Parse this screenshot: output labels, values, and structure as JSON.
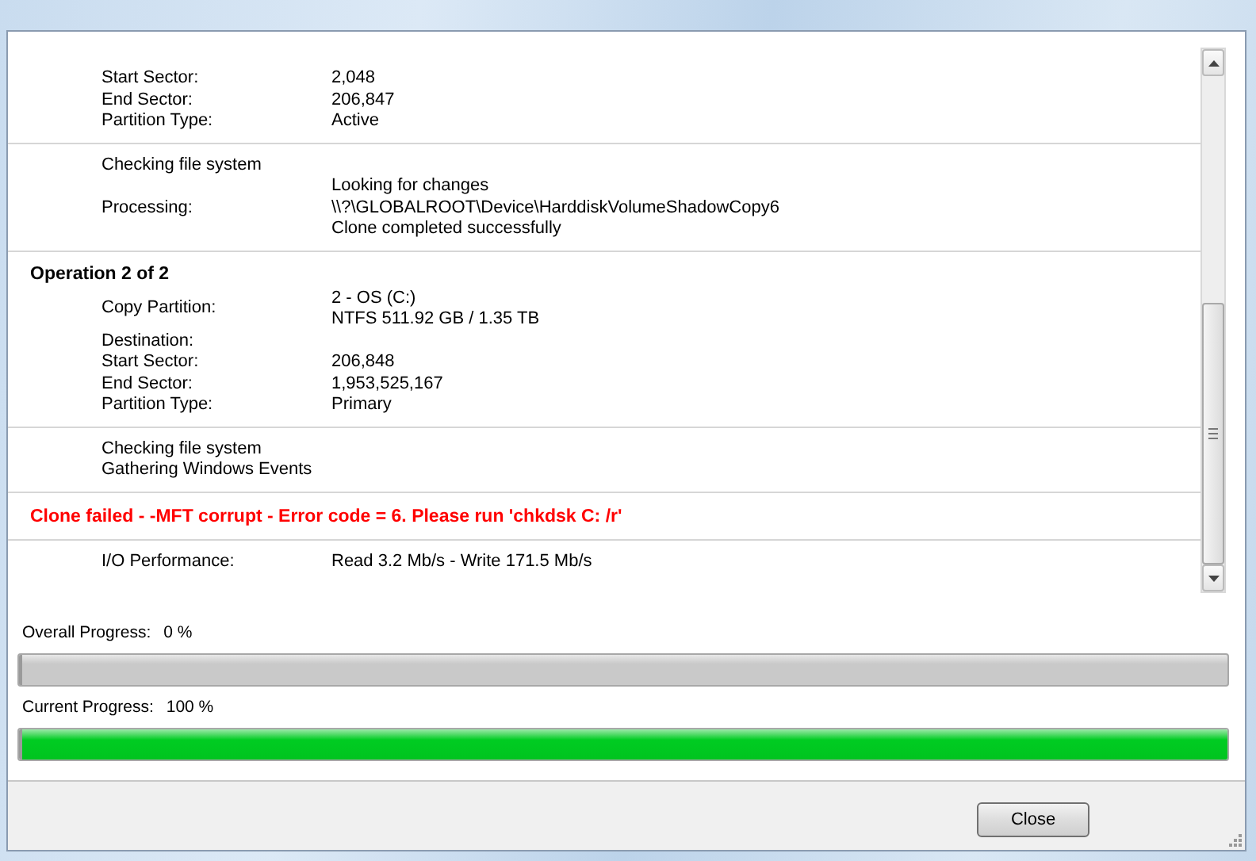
{
  "log": {
    "sections": [
      {
        "kind": "rows",
        "rows": [
          {
            "label": "Start Sector:",
            "values": [
              "2,048"
            ]
          },
          {
            "label": "End Sector:",
            "values": [
              "206,847"
            ]
          },
          {
            "label": "Partition Type:",
            "values": [
              "Active"
            ]
          }
        ]
      },
      {
        "kind": "rows",
        "rows": [
          {
            "label": "Checking file system",
            "values": []
          },
          {
            "label": "Processing:",
            "values": [
              "Looking for changes",
              "\\\\?\\GLOBALROOT\\Device\\HarddiskVolumeShadowCopy6",
              "Clone completed successfully"
            ]
          }
        ]
      },
      {
        "kind": "rows",
        "heading": "Operation 2 of 2",
        "rows": [
          {
            "label": "Copy Partition:",
            "values": [
              "2 - OS (C:)",
              "NTFS 511.92 GB / 1.35 TB"
            ]
          },
          {
            "label": "Destination:",
            "values": []
          },
          {
            "label": "Start Sector:",
            "values": [
              "206,848"
            ]
          },
          {
            "label": "End Sector:",
            "values": [
              "1,953,525,167"
            ]
          },
          {
            "label": "Partition Type:",
            "values": [
              "Primary"
            ]
          }
        ]
      },
      {
        "kind": "rows",
        "rows": [
          {
            "label": "Checking file system",
            "values": []
          },
          {
            "label": "Gathering Windows Events",
            "values": []
          }
        ]
      },
      {
        "kind": "error",
        "text": "Clone failed - -MFT corrupt - Error code = 6. Please run 'chkdsk C: /r'"
      },
      {
        "kind": "rows",
        "rows": [
          {
            "label": "I/O Performance:",
            "values": [
              "Read 3.2 Mb/s - Write 171.5 Mb/s"
            ]
          }
        ]
      }
    ]
  },
  "progress": [
    {
      "label": "Overall Progress:",
      "value": "0 %",
      "level": 0
    },
    {
      "label": "Current Progress:",
      "value": "100 %",
      "level": 1
    }
  ],
  "buttons": [
    "Close"
  ]
}
